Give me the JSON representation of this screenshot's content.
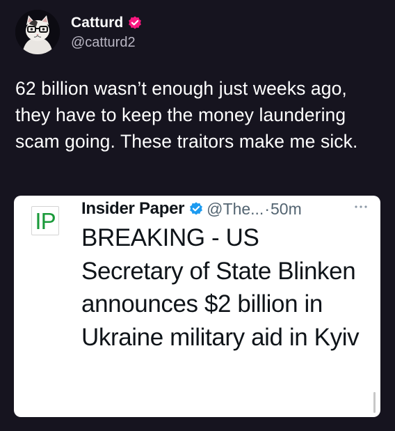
{
  "author": {
    "display_name": "Catturd",
    "handle": "@catturd2",
    "avatar_icon": "cat-with-glasses-avatar",
    "verified_icon": "verified-badge-icon",
    "verified_color": "#f91880"
  },
  "tweet": {
    "text": "62 billion wasn’t enough just weeks ago, they have to keep the money laundering scam going. These traitors make me sick."
  },
  "quoted_tweet": {
    "logo_text": "IP",
    "logo_color": "#1a9a3a",
    "display_name": "Insider Paper",
    "verified_icon": "verified-badge-icon",
    "verified_color": "#1d9bf0",
    "handle": "@The...",
    "separator": "·",
    "time": "50m",
    "more_icon": "more-dots-icon",
    "text": "BREAKING - US Secretary of State Blinken announces $2 billion in Ukraine military aid in Kyiv"
  },
  "colors": {
    "background": "#16141f",
    "card_background": "#ffffff",
    "secondary_text": "#536471"
  }
}
